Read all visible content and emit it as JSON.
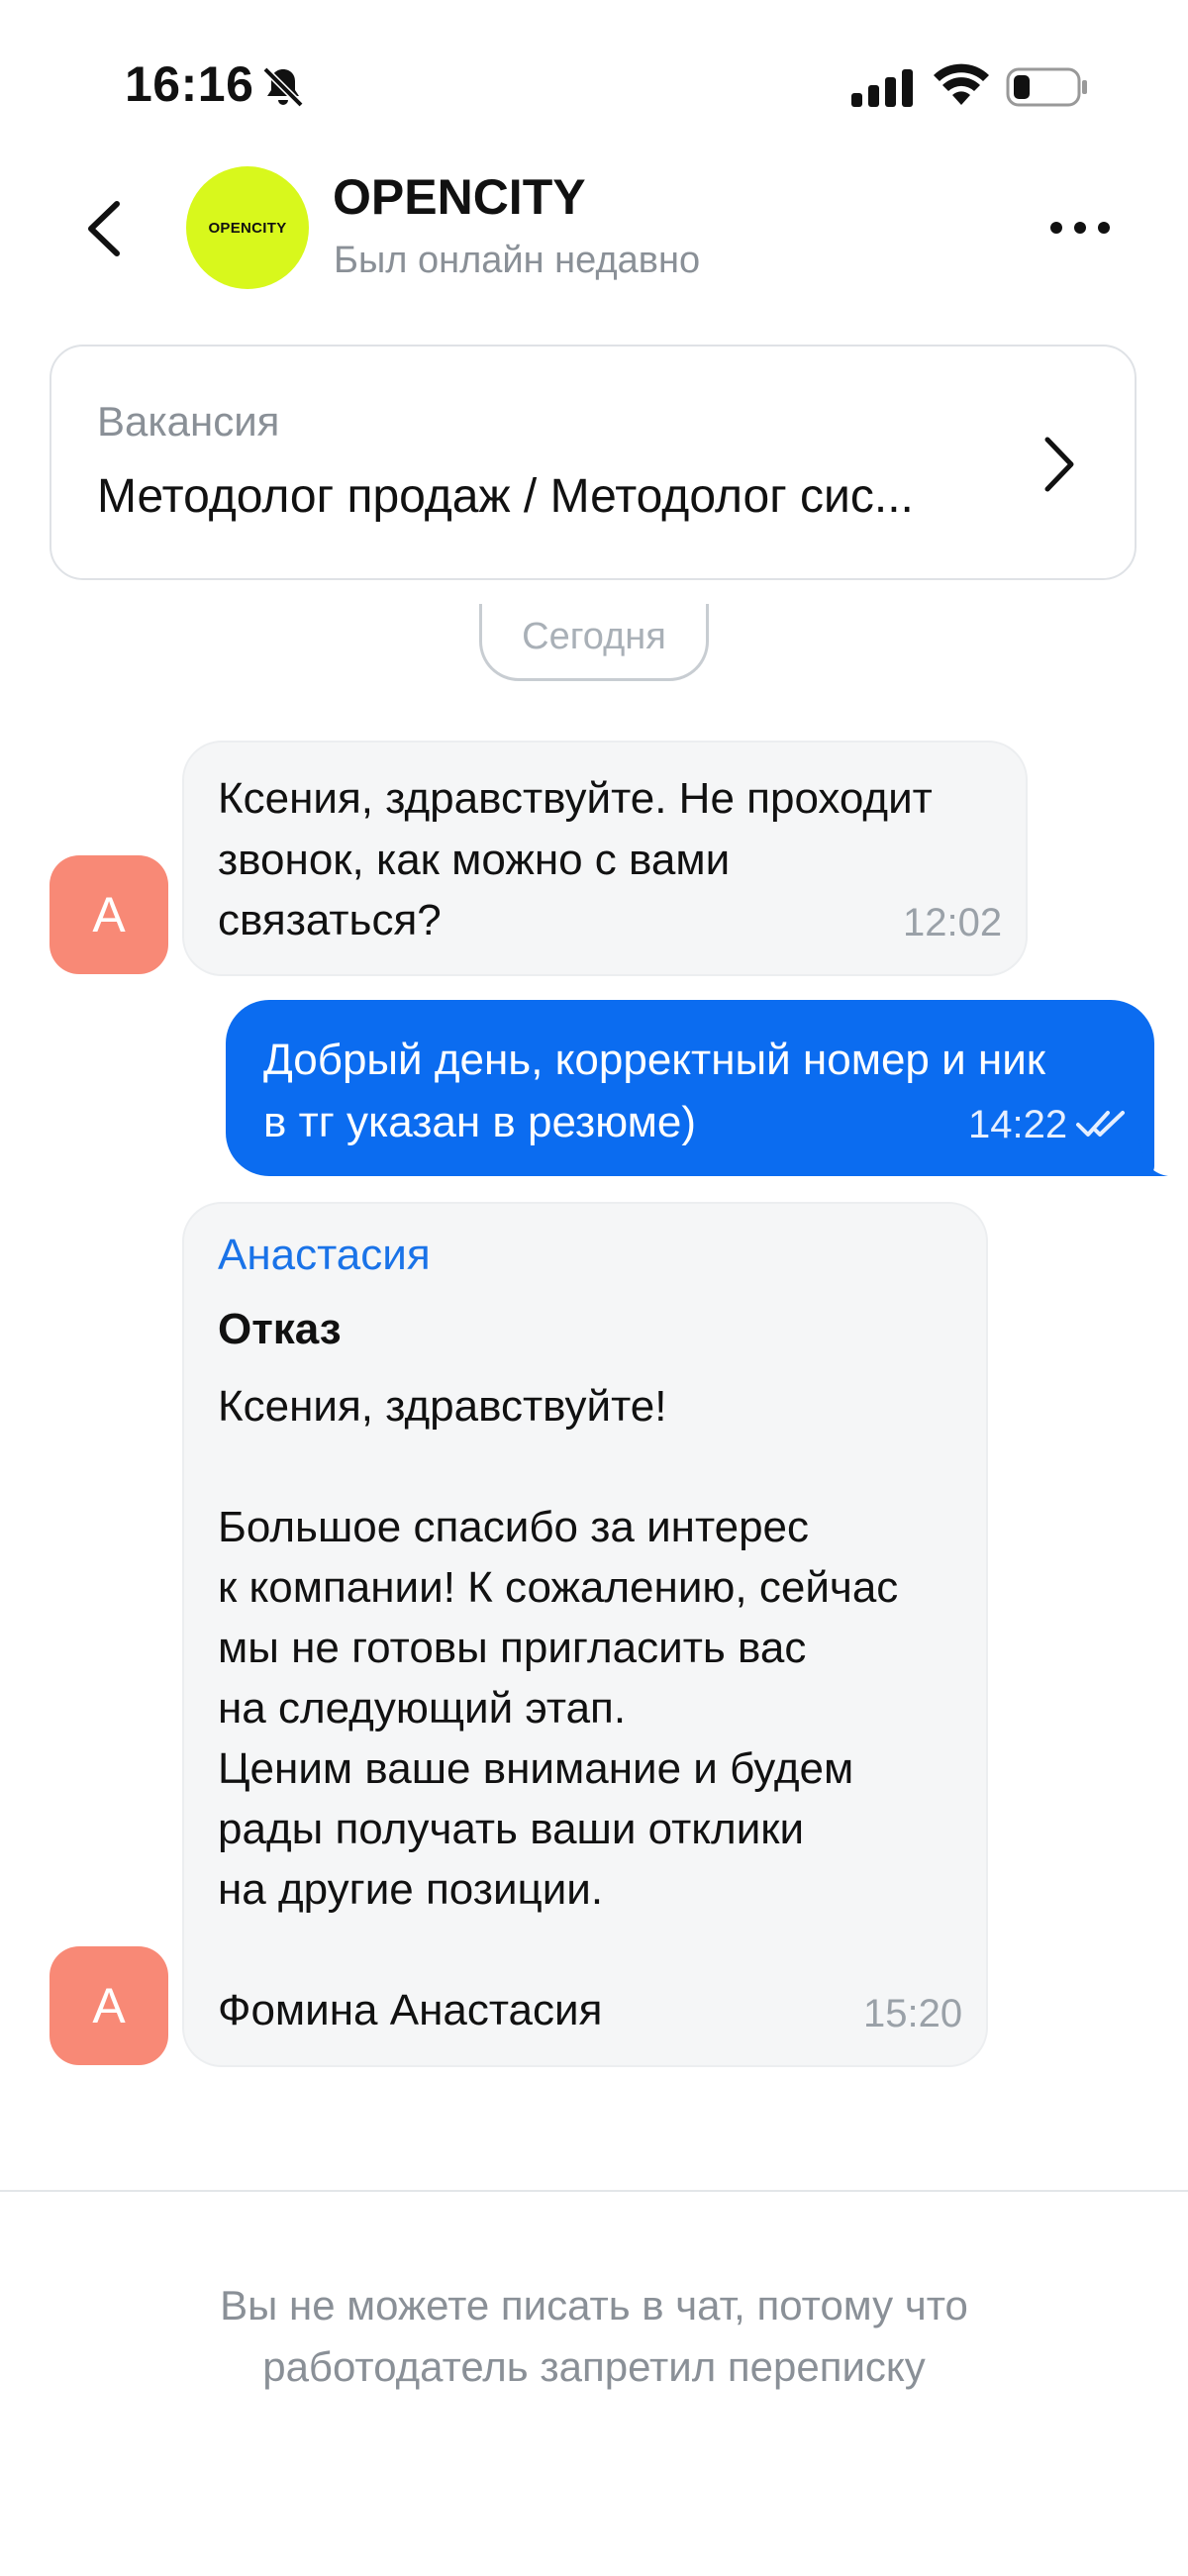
{
  "status_bar": {
    "time": "16:16"
  },
  "header": {
    "company_name": "OPENCITY",
    "avatar_text": "OPENCITY",
    "presence": "Был онлайн недавно"
  },
  "vacancy": {
    "label": "Вакансия",
    "title": "Методолог продаж / Методолог сис..."
  },
  "date_separator": "Сегодня",
  "messages": [
    {
      "avatar_letter": "А",
      "lines": [
        "Ксения, здравствуйте. Не проходит",
        "звонок, как можно с вами",
        "связаться?"
      ],
      "time": "12:02"
    },
    {
      "lines": [
        "Добрый день, корректный номер и ник",
        "в тг указан в резюме)"
      ],
      "time": "14:22"
    },
    {
      "avatar_letter": "А",
      "sender": "Анастасия",
      "subject": "Отказ",
      "lines": [
        "Ксения, здравствуйте!",
        "Большое спасибо за интерес",
        "к компании! К сожалению, сейчас",
        "мы не готовы пригласить вас",
        "на следующий этап.",
        "Ценим ваше внимание и будем",
        "рады получать ваши отклики",
        "на другие позиции.",
        "Фомина Анастасия"
      ],
      "time": "15:20"
    }
  ],
  "footer": {
    "line1": "Вы не можете писать в чат, потому что",
    "line2": "работодатель запретил переписку"
  },
  "colors": {
    "outgoing_bubble": "#0b6cf0",
    "incoming_bubble": "#f5f6f7",
    "avatar": "#f88976",
    "brand_avatar": "#d8f81c",
    "sender_name": "#1a73e8"
  }
}
